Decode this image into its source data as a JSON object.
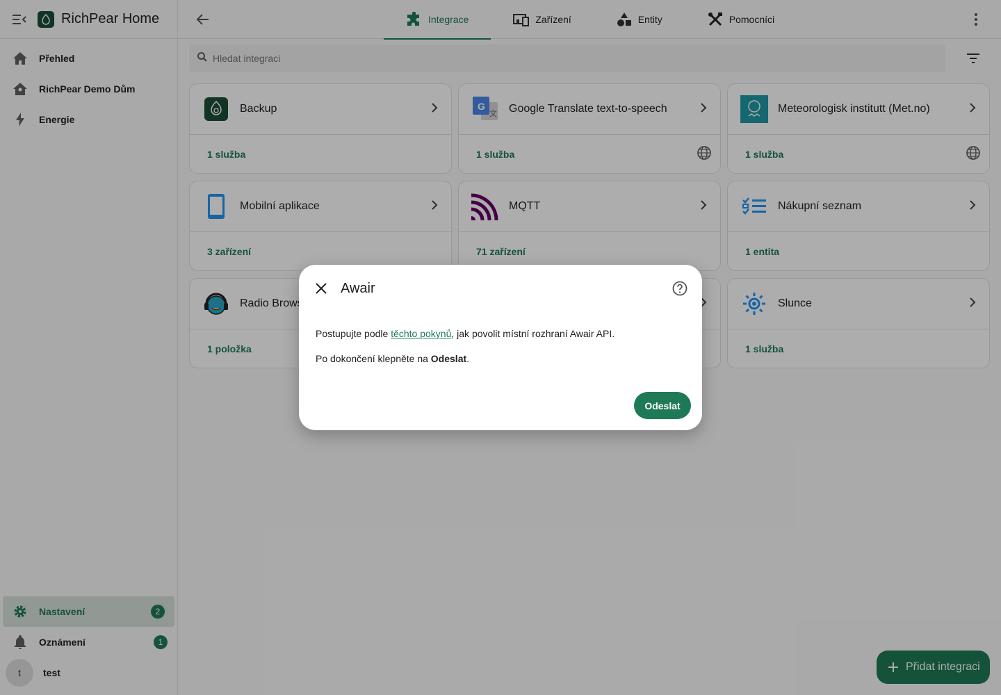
{
  "app": {
    "title": "RichPear Home"
  },
  "sidebar": {
    "items": [
      {
        "label": "Přehled",
        "icon": "home-icon"
      },
      {
        "label": "RichPear Demo Dům",
        "icon": "home-account-icon"
      },
      {
        "label": "Energie",
        "icon": "lightning-icon"
      }
    ],
    "settings": {
      "label": "Nastavení",
      "badge": "2"
    },
    "notifications": {
      "label": "Oznámení",
      "badge": "1"
    },
    "user": {
      "initial": "t",
      "name": "test"
    }
  },
  "tabs": [
    {
      "label": "Integrace",
      "icon": "puzzle-icon",
      "active": true
    },
    {
      "label": "Zařízení",
      "icon": "devices-icon"
    },
    {
      "label": "Entity",
      "icon": "shapes-icon"
    },
    {
      "label": "Pomocníci",
      "icon": "tools-icon"
    }
  ],
  "search": {
    "placeholder": "Hledat integraci"
  },
  "cards": [
    {
      "name": "Backup",
      "link": "1 služba",
      "cloud": false
    },
    {
      "name": "Google Translate text-to-speech",
      "link": "1 služba",
      "cloud": true
    },
    {
      "name": "Meteorologisk institutt (Met.no)",
      "link": "1 služba",
      "cloud": true
    },
    {
      "name": "Mobilní aplikace",
      "link": "3 zařízení",
      "cloud": false
    },
    {
      "name": "MQTT",
      "link": "71 zařízení",
      "cloud": false
    },
    {
      "name": "Nákupní seznam",
      "link": "1 entita",
      "cloud": false
    },
    {
      "name": "Radio Browser",
      "link": "1 položka",
      "cloud": false
    },
    {
      "name": "",
      "link": "",
      "cloud": false
    },
    {
      "name": "Slunce",
      "link": "1 služba",
      "cloud": false
    }
  ],
  "fab": {
    "label": "Přidat integraci"
  },
  "dialog": {
    "title": "Awair",
    "line1_pre": "Postupujte podle ",
    "line1_link": "těchto pokynů",
    "line1_post": ", jak povolit místní rozhraní Awair API.",
    "line2_pre": "Po dokončení klepněte na ",
    "line2_bold": "Odeslat",
    "line2_post": ".",
    "submit": "Odeslat"
  },
  "colors": {
    "accent": "#1e7a55",
    "brand_dark": "#1b4d37"
  }
}
